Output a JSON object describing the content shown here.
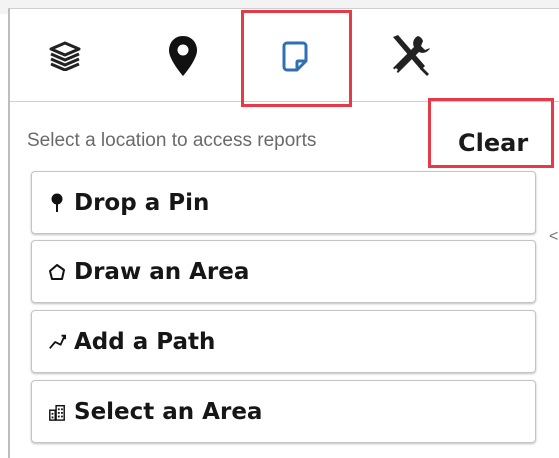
{
  "toolbar": {
    "tools": [
      {
        "icon": "layers-icon"
      },
      {
        "icon": "map-pin-icon"
      },
      {
        "icon": "report-page-icon",
        "active": true
      },
      {
        "icon": "tools-icon"
      }
    ],
    "active_color": "#2f6fb3",
    "highlight_color": "#e53b48"
  },
  "panel": {
    "hint": "Select a location to access reports",
    "clear_label": "Clear",
    "actions": [
      {
        "icon": "pin-icon",
        "label": "Drop a Pin"
      },
      {
        "icon": "polygon-icon",
        "label": "Draw an Area"
      },
      {
        "icon": "path-icon",
        "label": "Add a Path"
      },
      {
        "icon": "building-icon",
        "label": "Select an Area"
      }
    ]
  }
}
